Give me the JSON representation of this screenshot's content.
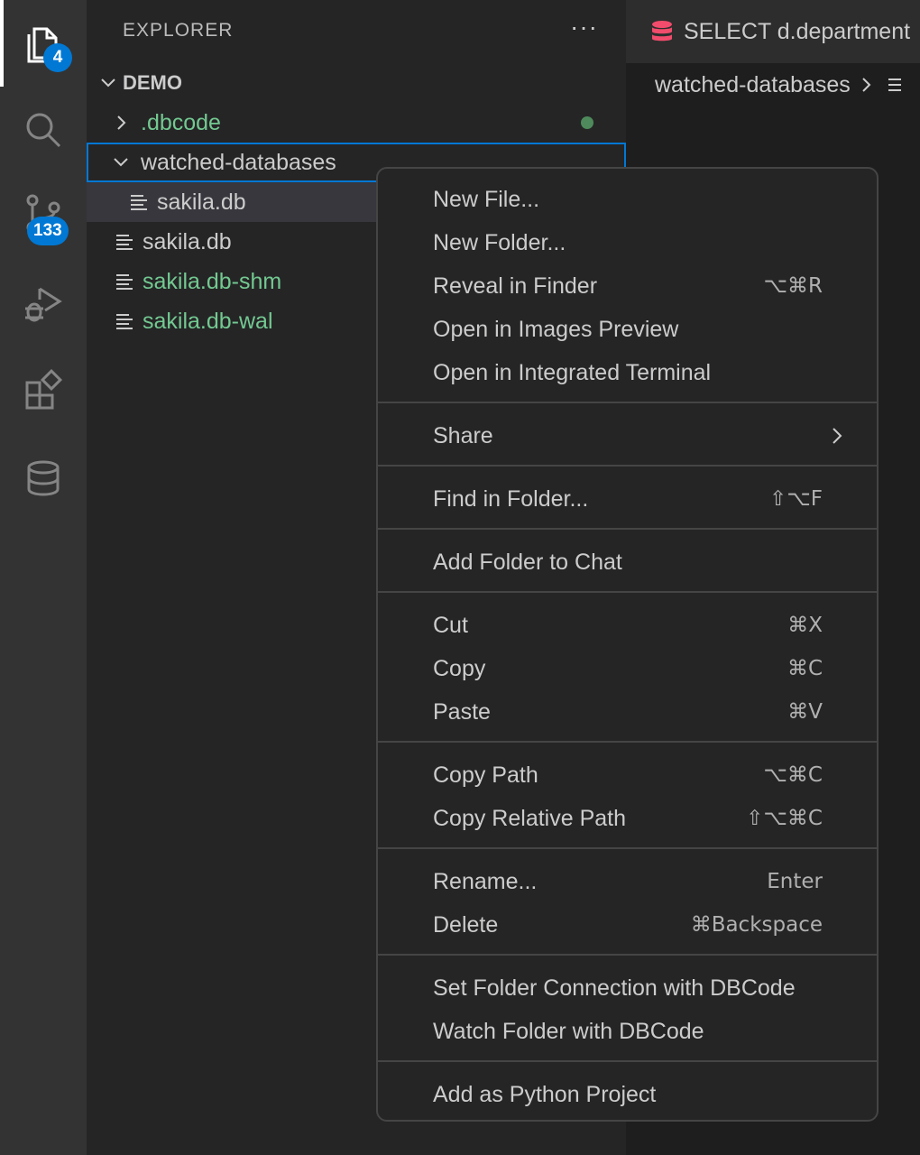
{
  "activity_bar": {
    "explorer_badge": "4",
    "scm_badge": "133"
  },
  "sidebar": {
    "title": "EXPLORER",
    "more_actions": "···",
    "workspace": "DEMO",
    "tree": [
      {
        "label": ".dbcode",
        "type": "folder",
        "expanded": false,
        "modified": true,
        "color": "#73c991"
      },
      {
        "label": "watched-databases",
        "type": "folder",
        "expanded": true
      },
      {
        "label": "sakila.db",
        "type": "file",
        "parent": "watched-databases"
      },
      {
        "label": "sakila.db",
        "type": "file"
      },
      {
        "label": "sakila.db-shm",
        "type": "file",
        "color": "#73c991"
      },
      {
        "label": "sakila.db-wal",
        "type": "file",
        "color": "#73c991"
      }
    ]
  },
  "editor": {
    "tab_label": "SELECT d.department",
    "breadcrumb": "watched-databases"
  },
  "context_menu": {
    "items": [
      {
        "label": "New File...",
        "shortcut": ""
      },
      {
        "label": "New Folder...",
        "shortcut": ""
      },
      {
        "label": "Reveal in Finder",
        "shortcut": "⌥⌘R"
      },
      {
        "label": "Open in Images Preview",
        "shortcut": ""
      },
      {
        "label": "Open in Integrated Terminal",
        "shortcut": ""
      },
      {
        "label": "Share",
        "shortcut": "",
        "submenu": true
      },
      {
        "label": "Find in Folder...",
        "shortcut": "⇧⌥F"
      },
      {
        "label": "Add Folder to Chat",
        "shortcut": ""
      },
      {
        "label": "Cut",
        "shortcut": "⌘X"
      },
      {
        "label": "Copy",
        "shortcut": "⌘C"
      },
      {
        "label": "Paste",
        "shortcut": "⌘V"
      },
      {
        "label": "Copy Path",
        "shortcut": "⌥⌘C"
      },
      {
        "label": "Copy Relative Path",
        "shortcut": "⇧⌥⌘C"
      },
      {
        "label": "Rename...",
        "shortcut": "Enter"
      },
      {
        "label": "Delete",
        "shortcut": "⌘Backspace"
      },
      {
        "label": "Set Folder Connection with DBCode",
        "shortcut": ""
      },
      {
        "label": "Watch Folder with DBCode",
        "shortcut": ""
      },
      {
        "label": "Add as Python Project",
        "shortcut": ""
      }
    ]
  },
  "colors": {
    "accent": "#0078d4",
    "git_untracked": "#73c991",
    "db_icon": "#f14c6c"
  }
}
